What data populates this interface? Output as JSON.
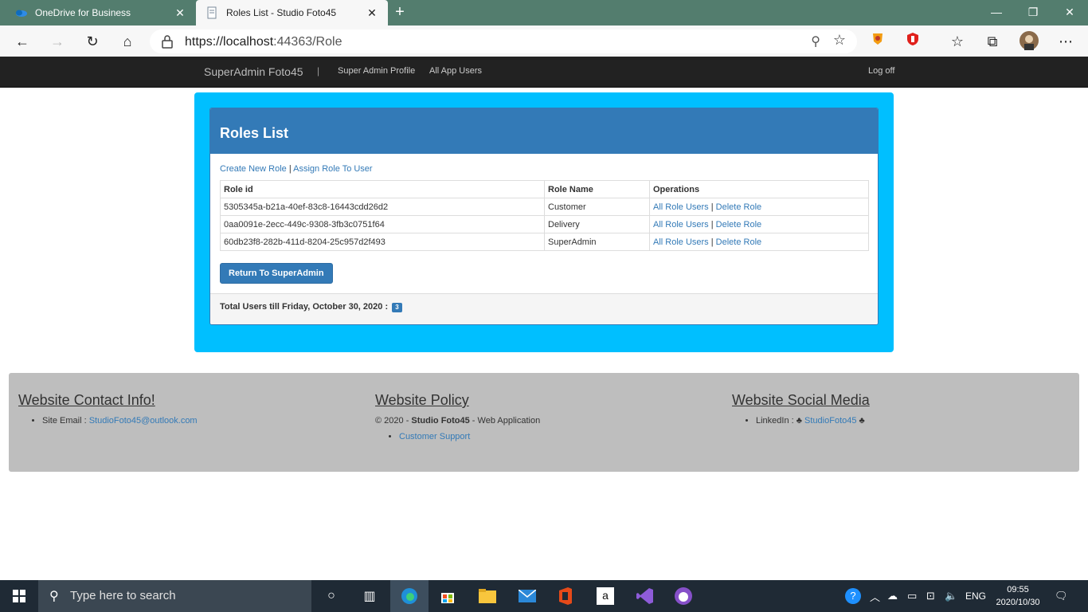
{
  "browser": {
    "tabs": [
      {
        "title": "OneDrive for Business",
        "close": "✕"
      },
      {
        "title": "Roles List - Studio Foto45",
        "close": "✕"
      }
    ],
    "new_tab": "+",
    "window_controls": {
      "minimize": "—",
      "restore": "❐",
      "close": "✕"
    },
    "url_host": "https://localhost",
    "url_rest": ":44363/Role"
  },
  "navbar": {
    "brand": "SuperAdmin Foto45",
    "separator": "|",
    "links": [
      "Super Admin Profile",
      "All App Users"
    ],
    "logoff": "Log off"
  },
  "panel": {
    "title": "Roles List",
    "create_link": "Create New Role",
    "divider": " | ",
    "assign_link": "Assign Role To User",
    "table": {
      "headers": [
        "Role id",
        "Role Name",
        "Operations"
      ],
      "rows": [
        {
          "id": "5305345a-b21a-40ef-83c8-16443cdd26d2",
          "name": "Customer",
          "op1": "All Role Users",
          "op2": "Delete Role"
        },
        {
          "id": "0aa0091e-2ecc-449c-9308-3fb3c0751f64",
          "name": "Delivery",
          "op1": "All Role Users",
          "op2": "Delete Role"
        },
        {
          "id": "60db23f8-282b-411d-8204-25c957d2f493",
          "name": "SuperAdmin",
          "op1": "All Role Users",
          "op2": "Delete Role"
        }
      ]
    },
    "return_button": "Return To SuperAdmin",
    "footer_text": "Total Users till Friday, October 30, 2020 :",
    "footer_badge": "3"
  },
  "footer": {
    "contact": {
      "heading": "Website Contact Info!",
      "email_label": "Site Email : ",
      "email": "StudioFoto45@outlook.com"
    },
    "policy": {
      "heading": "Website Policy",
      "copyright_prefix": "© 2020 - ",
      "company": "Studio Foto45",
      "copyright_suffix": " - Web Application",
      "support": "Customer Support"
    },
    "social": {
      "heading": "Website Social Media",
      "linkedin_label": "LinkedIn : ♣ ",
      "linkedin": "StudioFoto45",
      "linkedin_suffix": " ♣"
    }
  },
  "taskbar": {
    "search_placeholder": "Type here to search",
    "lang": "ENG",
    "time": "09:55",
    "date": "2020/10/30"
  },
  "colors": {
    "accent": "#337ab7",
    "outer_bg": "#00bfff",
    "navbar_bg": "#222222",
    "footer_bg": "#bebebe"
  }
}
